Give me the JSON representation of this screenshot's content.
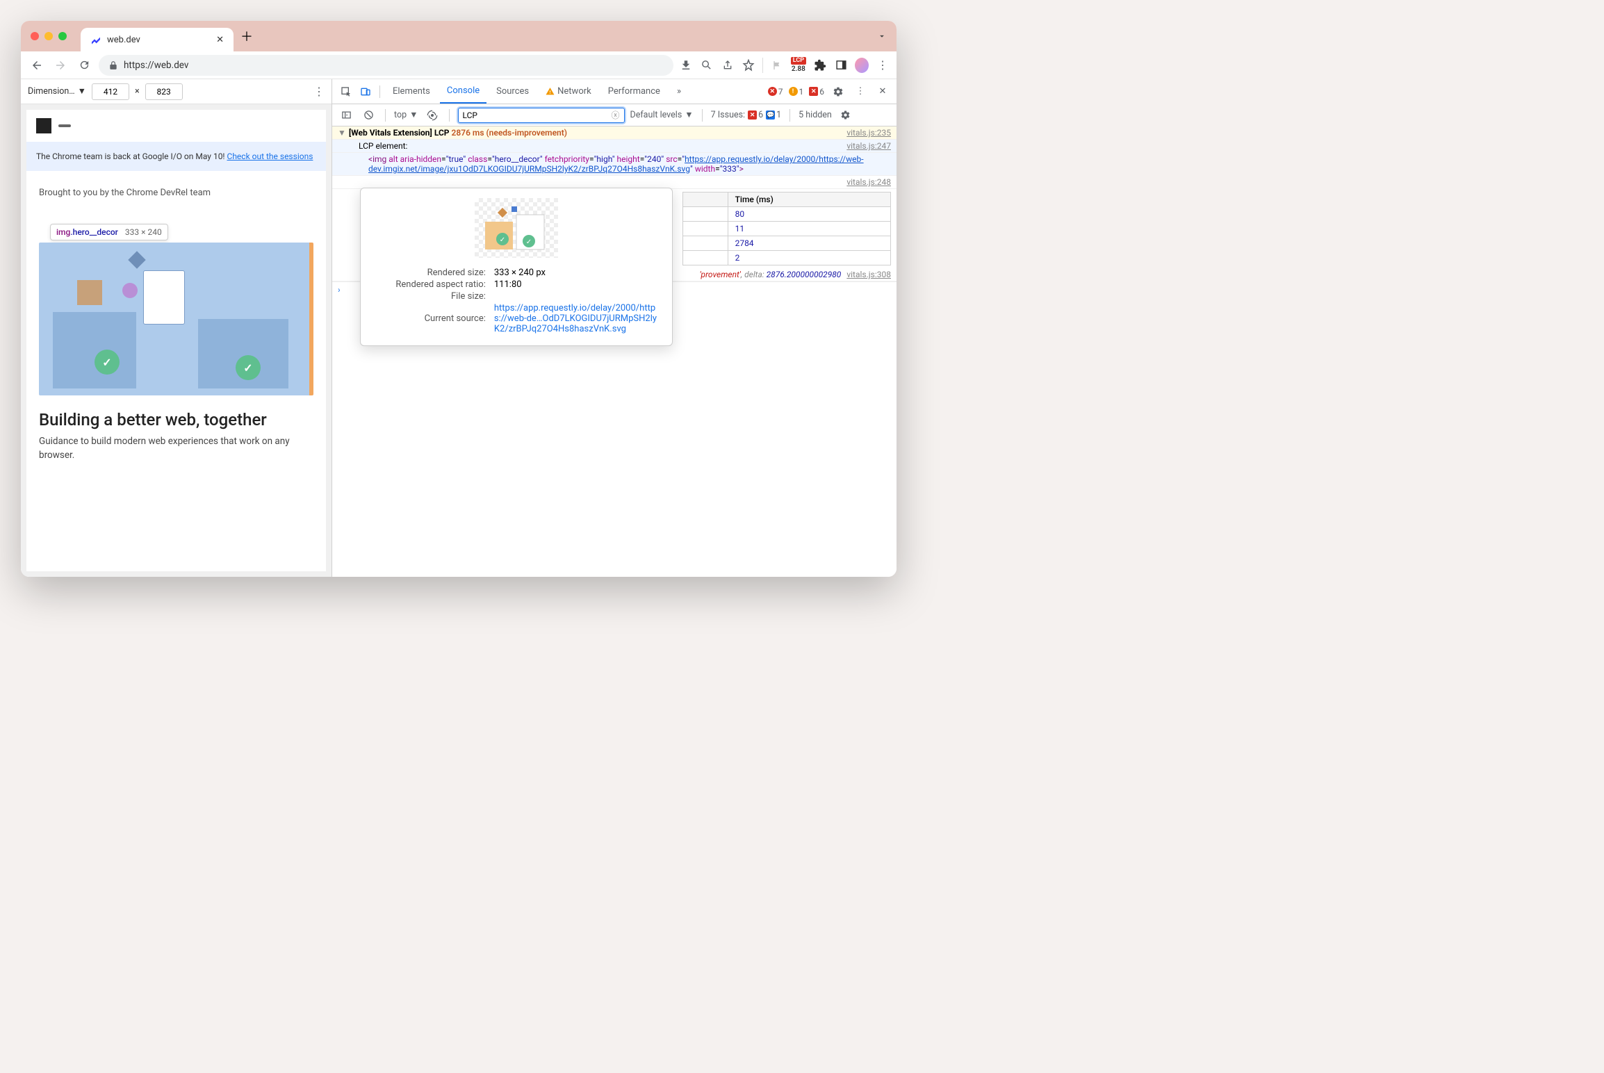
{
  "chrome": {
    "tab_title": "web.dev",
    "url": "https://web.dev",
    "lcp_badge_label": "LCP",
    "lcp_badge_value": "2.88"
  },
  "device_toolbar": {
    "label": "Dimension…",
    "width": "412",
    "height": "823",
    "sep": "×"
  },
  "page": {
    "banner_text": "The Chrome team is back at Google I/O on May 10! ",
    "banner_link": "Check out the sessions",
    "devrel": "Brought to you by the Chrome DevRel team",
    "hero_title": "Building a better web, together",
    "hero_subtitle": "Guidance to build modern web experiences that work on any browser."
  },
  "element_tip": {
    "tag": "img",
    "cls": ".hero__decor",
    "dims": "333 × 240"
  },
  "devtools": {
    "tabs": [
      "Elements",
      "Console",
      "Sources",
      "Network",
      "Performance"
    ],
    "active_tab": "Console",
    "more": "»",
    "errors": "7",
    "warnings": "1",
    "blocked": "6",
    "filter": {
      "context": "top",
      "value": "LCP",
      "levels": "Default levels",
      "issues_label": "7 Issues:",
      "issues_err": "6",
      "issues_info": "1",
      "hidden": "5 hidden"
    }
  },
  "console": {
    "line1_prefix": "[Web Vitals Extension] LCP ",
    "line1_ms": "2876 ms",
    "line1_status": " (needs-improvement)",
    "line1_src": "vitals.js:235",
    "line2_label": "LCP element:",
    "line2_src": "vitals.js:247",
    "img_html_1": "<img alt aria-hidden=\"true\" class=\"hero__decor\" fetchpriority=\"high\" height=\"240\" src=\"",
    "img_url": "https://app.requestly.io/delay/2000/https://web-dev.imgix.net/image/jxu1OdD7LKOGIDU7jURMpSH2lyK2/zrBPJq27O4Hs8haszVnK.svg",
    "img_html_2": "\" width=\"333\">",
    "table_src": "vitals.js:248",
    "log_src": "vitals.js:308",
    "log_partial_rating": "'provement'",
    "log_delta_label": ", delta: ",
    "log_delta": "2876.200000002980",
    "table": {
      "headers": [
        "",
        "Time (ms)"
      ],
      "rows": [
        [
          "",
          "80"
        ],
        [
          "",
          "11"
        ],
        [
          "",
          "2784"
        ],
        [
          "",
          "2"
        ]
      ]
    }
  },
  "popup": {
    "rendered_size_label": "Rendered size:",
    "rendered_size": "333 × 240 px",
    "aspect_label": "Rendered aspect ratio:",
    "aspect": "111:80",
    "filesize_label": "File size:",
    "filesize": "",
    "source_label": "Current source:",
    "source": "https://app.requestly.io/delay/2000/https://web-de…OdD7LKOGIDU7jURMpSH2lyK2/zrBPJq27O4Hs8haszVnK.svg"
  }
}
